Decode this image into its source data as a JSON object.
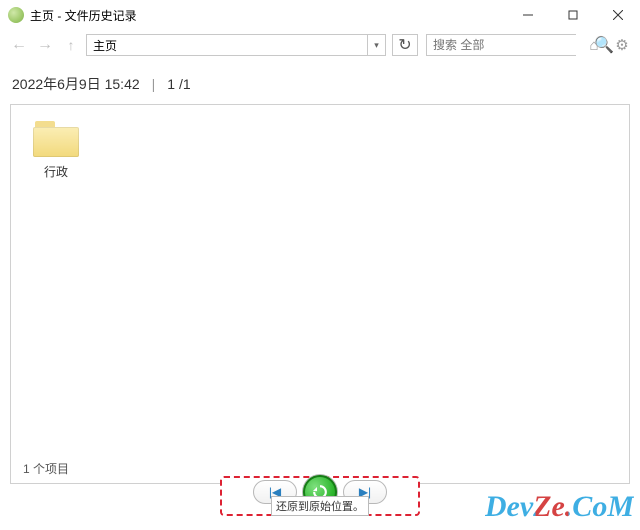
{
  "window": {
    "title": "主页 - 文件历史记录"
  },
  "navbar": {
    "address": "主页",
    "search_placeholder": "搜索 全部"
  },
  "page": {
    "timestamp": "2022年6月9日 15:42",
    "separator": "|",
    "page_indicator": "1 /1"
  },
  "items": [
    {
      "name": "行政"
    }
  ],
  "status": {
    "item_count_text": "1 个项目"
  },
  "controls": {
    "tooltip": "还原到原始位置。"
  },
  "watermark": "DevZe.CoM"
}
